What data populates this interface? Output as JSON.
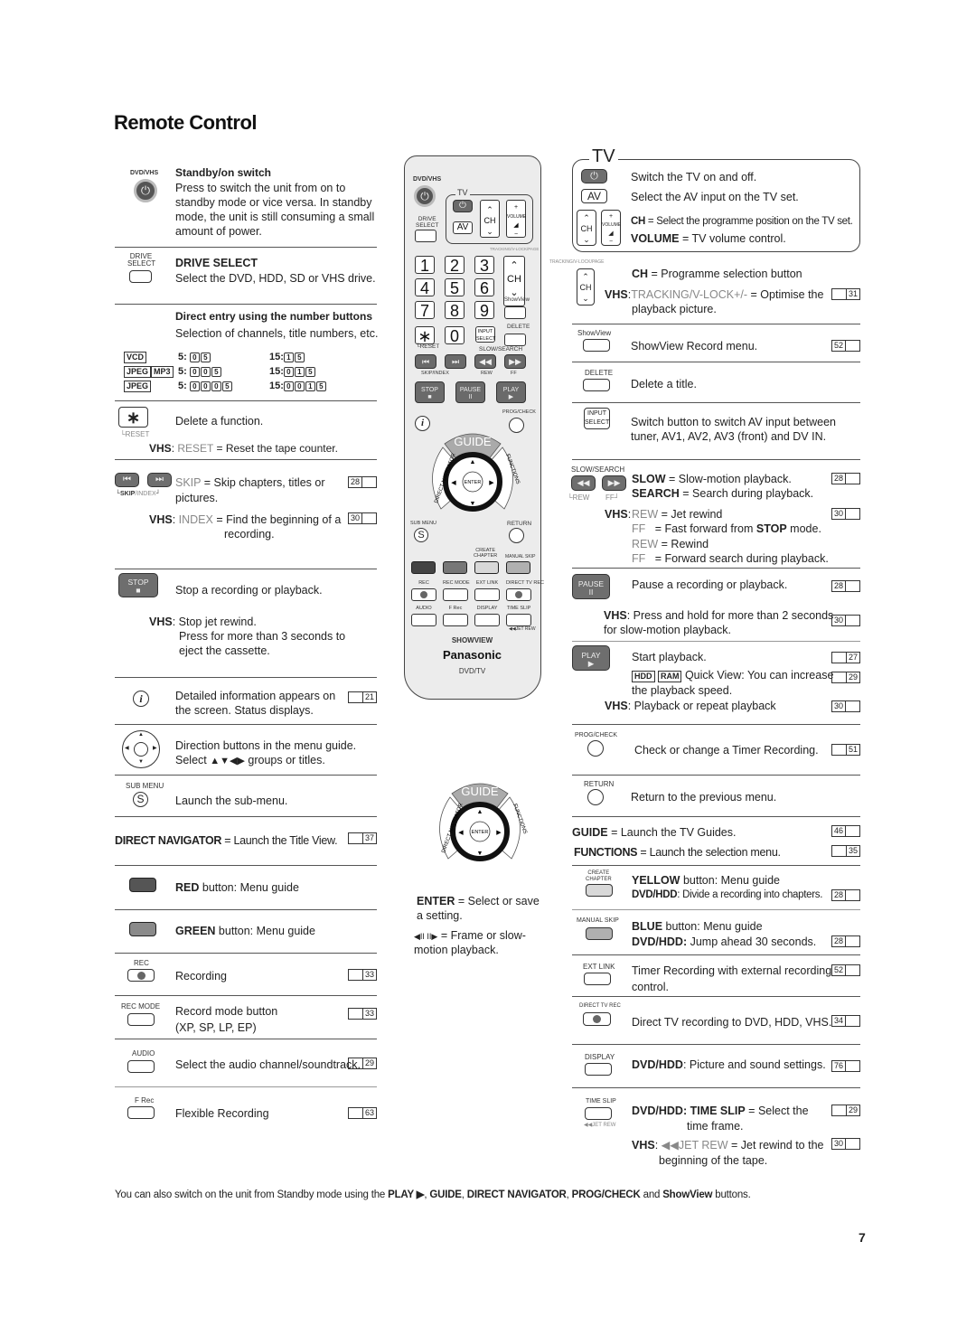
{
  "page": {
    "title": "Remote Control",
    "page_number": "7",
    "footer_note_parts": [
      "You can also switch on the unit from Standby mode using the ",
      "PLAY ▶",
      ", ",
      "GUIDE",
      ", ",
      "DIRECT NAVIGATOR",
      ", ",
      "PROG/CHECK",
      " and ",
      "ShowView",
      " buttons."
    ]
  },
  "left": {
    "standby": {
      "label_top": "DVD/VHS",
      "title": "Standby/on switch",
      "text": "Press to switch the unit from on to standby mode or vice versa. In standby mode, the unit is still consuming a small amount of power."
    },
    "drive_select": {
      "label": "DRIVE SELECT",
      "btn_label1": "DRIVE",
      "btn_label2": "SELECT",
      "text": "Select the DVD, HDD, SD or VHS drive."
    },
    "direct_entry": {
      "title": "Direct entry using the number buttons",
      "text": "Selection of channels, title numbers, etc.",
      "rows": [
        {
          "tags": [
            "VCD"
          ],
          "a_prefix": "5:",
          "a_keys": [
            "0",
            "5"
          ],
          "b_prefix": "15:",
          "b_keys": [
            "1",
            "5"
          ]
        },
        {
          "tags": [
            "JPEG",
            "MP3"
          ],
          "a_prefix": "5:",
          "a_keys": [
            "0",
            "0",
            "5"
          ],
          "b_prefix": "15:",
          "b_keys": [
            "0",
            "1",
            "5"
          ]
        },
        {
          "tags": [
            "JPEG"
          ],
          "a_prefix": "5:",
          "a_keys": [
            "0",
            "0",
            "0",
            "5"
          ],
          "b_prefix": "15:",
          "b_keys": [
            "0",
            "0",
            "1",
            "5"
          ]
        }
      ]
    },
    "delete": {
      "sub_label": "RESET",
      "text": "Delete a function.",
      "vhs_prefix": "VHS",
      "vhs_key": "RESET",
      "vhs_text": " = Reset the tape counter."
    },
    "skip": {
      "sub_label_a": "SKIP",
      "sub_label_b": "/INDEX",
      "key": "SKIP",
      "text": " = Skip chapters, titles or",
      "text2": "pictures.",
      "ref": "28",
      "vhs_prefix": "VHS",
      "vhs_key": "INDEX",
      "vhs_text": " = Find the beginning of a",
      "vhs_text2": "recording.",
      "vhs_ref": "30"
    },
    "stop": {
      "btn": "STOP",
      "text": "Stop a recording or playback.",
      "vhs_prefix": "VHS",
      "vhs_text": ": Stop jet rewind.",
      "vhs_text2": "Press for more than 3 seconds to",
      "vhs_text3": "eject the cassette."
    },
    "info": {
      "text": "Detailed information appears on",
      "text2": "the screen. Status displays.",
      "ref": "21"
    },
    "direction": {
      "text": "Direction buttons in the menu guide.",
      "text2_pre": "Select ",
      "arrows": "▲▼◀▶",
      "text2_post": " groups or titles."
    },
    "submenu": {
      "label": "SUB MENU",
      "glyph": "S",
      "text": "Launch the sub-menu."
    },
    "direct_navigator": {
      "key": "DIRECT NAVIGATOR",
      "text": " = Launch the Title View.",
      "ref": "37"
    },
    "red": {
      "key": "RED",
      "text": " button: Menu guide",
      "color": "#555555"
    },
    "green": {
      "key": "GREEN",
      "text": " button: Menu guide",
      "color": "#8a8a8a"
    },
    "rec": {
      "label": "REC",
      "text": "Recording",
      "ref": "33"
    },
    "rec_mode": {
      "label": "REC MODE",
      "text": "Record mode button",
      "text2": "(XP, SP, LP, EP)",
      "ref": "33"
    },
    "audio": {
      "label": "AUDIO",
      "text": "Select the audio channel/soundtrack.",
      "ref": "29"
    },
    "frec": {
      "label": "F Rec",
      "text": "Flexible Recording",
      "ref": "63"
    }
  },
  "remote": {
    "dvdvhs": "DVD/VHS",
    "tv": "TV",
    "drive1": "DRIVE",
    "drive2": "SELECT",
    "av": "AV",
    "ch": "CH",
    "volume": "VOLUME",
    "tracking": "TRACKING/V-LOCK/PAGE",
    "digits": [
      "1",
      "2",
      "3",
      "4",
      "5",
      "6",
      "7",
      "8",
      "9",
      "∗",
      "0"
    ],
    "showview": "ShowView",
    "delete": "DELETE",
    "input1": "INPUT",
    "input2": "SELECT",
    "reset": "RESET",
    "slow_search": "SLOW/SEARCH",
    "skip_index": "SKIP/INDEX",
    "rew": "REW",
    "ff": "FF",
    "stop": "STOP",
    "pause": "PAUSE",
    "play": "PLAY",
    "prog_check": "PROG/CHECK",
    "guide": "GUIDE",
    "direct_navigator": "DIRECT NAVIGATOR",
    "functions": "FUNCTIONS",
    "enter": "ENTER",
    "sub_menu": "SUB MENU",
    "return": "RETURN",
    "create_chapter1": "CREATE",
    "create_chapter2": "CHAPTER",
    "manual_skip": "MANUAL SKIP",
    "rec": "REC",
    "rec_mode": "REC MODE",
    "ext_link": "EXT LINK",
    "direct_tv_rec": "DIRECT TV REC",
    "audio": "AUDIO",
    "frec": "F Rec",
    "display": "DISPLAY",
    "time_slip": "TIME SLIP",
    "jet_rew": "◀◀JET REW",
    "showview_logo": "SHOWVIEW",
    "brand": "Panasonic",
    "model": "DVD/TV",
    "colors": {
      "red": "#444444",
      "green": "#777777",
      "yellow": "#d8d8d8",
      "blue": "#b0b0b0"
    }
  },
  "center": {
    "enter_key": "ENTER",
    "enter_text": " = Select or save",
    "enter_text2": "a setting.",
    "frame_glyphs": "◀II   II▶",
    "frame_text": " = Frame or slow-",
    "frame_text2": "motion playback."
  },
  "right": {
    "tv_box": {
      "title": "TV",
      "power_text": "Switch the TV on and off.",
      "av_label": "AV",
      "av_text": "Select the AV input on the TV set.",
      "ch_key": "CH",
      "ch_text": " = Select the programme position on the TV set.",
      "vol_key": "VOLUME",
      "vol_text": " = TV volume control."
    },
    "ch": {
      "label": "TRACKING/V-LOCK/PAGE",
      "key": "CH",
      "text": " = Programme selection button",
      "vhs_prefix": "VHS",
      "vhs_key": "TRACKING/V-LOCK+/-",
      "vhs_text": " = Optimise the",
      "vhs_text2": "playback picture.",
      "ref": "31"
    },
    "showview": {
      "label": "ShowView",
      "text": "ShowView Record menu.",
      "ref": "52"
    },
    "delete": {
      "label": "DELETE",
      "text": "Delete a title."
    },
    "input_select": {
      "label1": "INPUT",
      "label2": "SELECT",
      "text": "Switch button to switch AV input between",
      "text2": "tuner, AV1, AV2, AV3 (front) and DV IN."
    },
    "slow_search": {
      "label": "SLOW/SEARCH",
      "rew": "REW",
      "ff": "FF",
      "slow_key": "SLOW",
      "slow_text": " = Slow-motion playback.",
      "search_key": "SEARCH",
      "search_text": " = Search during playback.",
      "ref": "28",
      "vhs_prefix": "VHS",
      "vhs_lines": [
        {
          "key": "REW",
          "text": " = Jet rewind"
        },
        {
          "key": "FF",
          "text": "   = Fast forward from ",
          "bold": "STOP",
          "tail": " mode."
        },
        {
          "key": "REW",
          "text": " = Rewind"
        },
        {
          "key": "FF",
          "text": "   = Forward search during playback."
        }
      ],
      "vhs_ref": "30"
    },
    "pause": {
      "btn": "PAUSE",
      "text": "Pause a recording or playback.",
      "ref": "28",
      "vhs_prefix": "VHS",
      "vhs_text": ": Press and hold for more than 2 seconds",
      "vhs_text2": "for slow-motion playback.",
      "vhs_ref": "30"
    },
    "play": {
      "btn": "PLAY",
      "text": "Start playback.",
      "ref": "27",
      "tags": [
        "HDD",
        "RAM"
      ],
      "quick": " Quick View: You can increase",
      "quick2": "the playback speed.",
      "quick_ref": "29",
      "vhs_prefix": "VHS",
      "vhs_text": ": Playback or repeat playback",
      "vhs_ref": "30"
    },
    "prog_check": {
      "label": "PROG/CHECK",
      "text": "Check or change a Timer Recording.",
      "ref": "51"
    },
    "return": {
      "label": "RETURN",
      "text": "Return to the previous menu."
    },
    "guide": {
      "key": "GUIDE",
      "text": " = Launch the TV Guides.",
      "ref": "46",
      "f_key": "FUNCTIONS",
      "f_text": " = Launch the selection menu.",
      "f_ref": "35"
    },
    "yellow": {
      "label1": "CREATE",
      "label2": "CHAPTER",
      "key": "YELLOW",
      "text": " button: Menu guide",
      "sub_key": "DVD/HDD",
      "sub_text": ": Divide a recording into chapters.",
      "ref": "28"
    },
    "blue": {
      "label": "MANUAL SKIP",
      "key": "BLUE",
      "text": " button: Menu guide",
      "sub_key": "DVD/HDD:",
      "sub_text": " Jump ahead 30 seconds.",
      "ref": "28"
    },
    "ext_link": {
      "label": "EXT LINK",
      "text": "Timer Recording with external recording",
      "text2": "control.",
      "ref": "52"
    },
    "direct_tv_rec": {
      "label": "DIRECT TV REC",
      "text": "Direct TV recording to DVD, HDD, VHS.",
      "ref": "34"
    },
    "display": {
      "label": "DISPLAY",
      "key": "DVD/HDD",
      "text": ": Picture and sound settings.",
      "ref": "76"
    },
    "time_slip": {
      "label": "TIME SLIP",
      "sub": "◀◀JET REW",
      "key": "DVD/HDD: TIME SLIP",
      "text": " = Select the",
      "text2": "time frame.",
      "ref": "29",
      "vhs_prefix": "VHS",
      "vhs_key": "◀◀JET REW",
      "vhs_text": " = Jet rewind to the",
      "vhs_text2": "beginning of the tape.",
      "vhs_ref": "30"
    }
  }
}
